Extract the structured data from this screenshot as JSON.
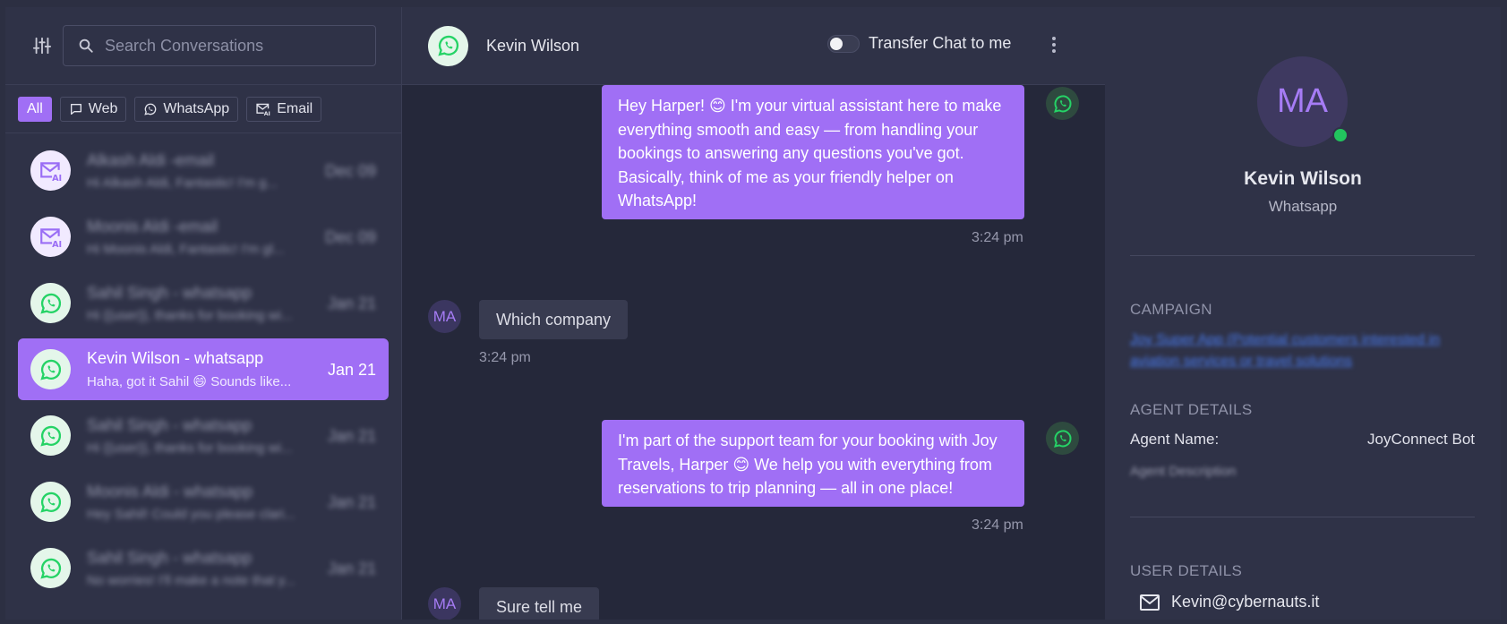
{
  "sidebar": {
    "search_placeholder": "Search Conversations",
    "channel_tabs": [
      {
        "label": "All",
        "icon": "none",
        "active": true
      },
      {
        "label": "Web",
        "icon": "chat-bubble-icon",
        "active": false
      },
      {
        "label": "WhatsApp",
        "icon": "whatsapp-icon",
        "active": false
      },
      {
        "label": "Email",
        "icon": "ai-mail-icon",
        "active": false
      }
    ],
    "conversations": [
      {
        "name": "Alkash Aldi -email",
        "preview": "Hi Alkash Aldi, Fantastic! I'm g...",
        "date": "Dec 09",
        "channel": "email",
        "blurred": true
      },
      {
        "name": "Moonis Aldi -email",
        "preview": "Hi Moonis Aldi, Fantastic! I'm gl...",
        "date": "Dec 09",
        "channel": "email",
        "blurred": true
      },
      {
        "name": "Sahil Singh - whatsapp",
        "preview": "Hi {{user}}, thanks for booking wi...",
        "date": "Jan 21",
        "channel": "whatsapp",
        "blurred": true
      },
      {
        "name": "Kevin Wilson - whatsapp",
        "preview": "Haha, got it Sahil 😄 Sounds like...",
        "date": "Jan 21",
        "channel": "whatsapp",
        "blurred": false,
        "active": true
      },
      {
        "name": "Sahil Singh - whatsapp",
        "preview": "Hi {{user}}, thanks for booking wi...",
        "date": "Jan 21",
        "channel": "whatsapp",
        "blurred": true
      },
      {
        "name": "Moonis Aldi - whatsapp",
        "preview": "Hey Sahil! Could you please clari...",
        "date": "Jan 21",
        "channel": "whatsapp",
        "blurred": true
      },
      {
        "name": "Sahil Singh - whatsapp",
        "preview": "No worries! I'll make a note that y...",
        "date": "Jan 21",
        "channel": "whatsapp",
        "blurred": true
      }
    ]
  },
  "chat": {
    "title": "Kevin Wilson",
    "transfer_label": "Transfer Chat to me",
    "transfer_enabled": false,
    "messages": [
      {
        "direction": "out",
        "text": "Hey Harper! 😊 I'm your virtual assistant here to make everything smooth and easy — from handling your bookings to answering any questions you've got. Basically, think of me as your friendly helper on WhatsApp!",
        "time": "3:24 pm"
      },
      {
        "direction": "in",
        "sender": "MA",
        "text": "Which company",
        "time": "3:24 pm"
      },
      {
        "direction": "out",
        "text": "I'm part of the support team for your booking with Joy Travels, Harper 😊 We help you with everything from reservations to trip planning — all in one place!",
        "time": "3:24 pm"
      },
      {
        "direction": "in",
        "sender": "MA",
        "text": "Sure tell me",
        "time": ""
      }
    ]
  },
  "profile": {
    "initials": "MA",
    "name": "Kevin Wilson",
    "channel": "Whatsapp",
    "campaign_title": "CAMPAIGN",
    "campaign_link": "Joy Super App (Potential customers interested in aviation services or travel solutions",
    "agent_title": "AGENT DETAILS",
    "agent_name_label": "Agent Name:",
    "agent_name_value": "JoyConnect Bot",
    "agent_description": "Agent Description",
    "user_title": "USER DETAILS",
    "email": "Kevin@cybernauts.it"
  },
  "colors": {
    "accent": "#a06ff5",
    "whatsapp": "#25d366",
    "online": "#22c55e"
  }
}
